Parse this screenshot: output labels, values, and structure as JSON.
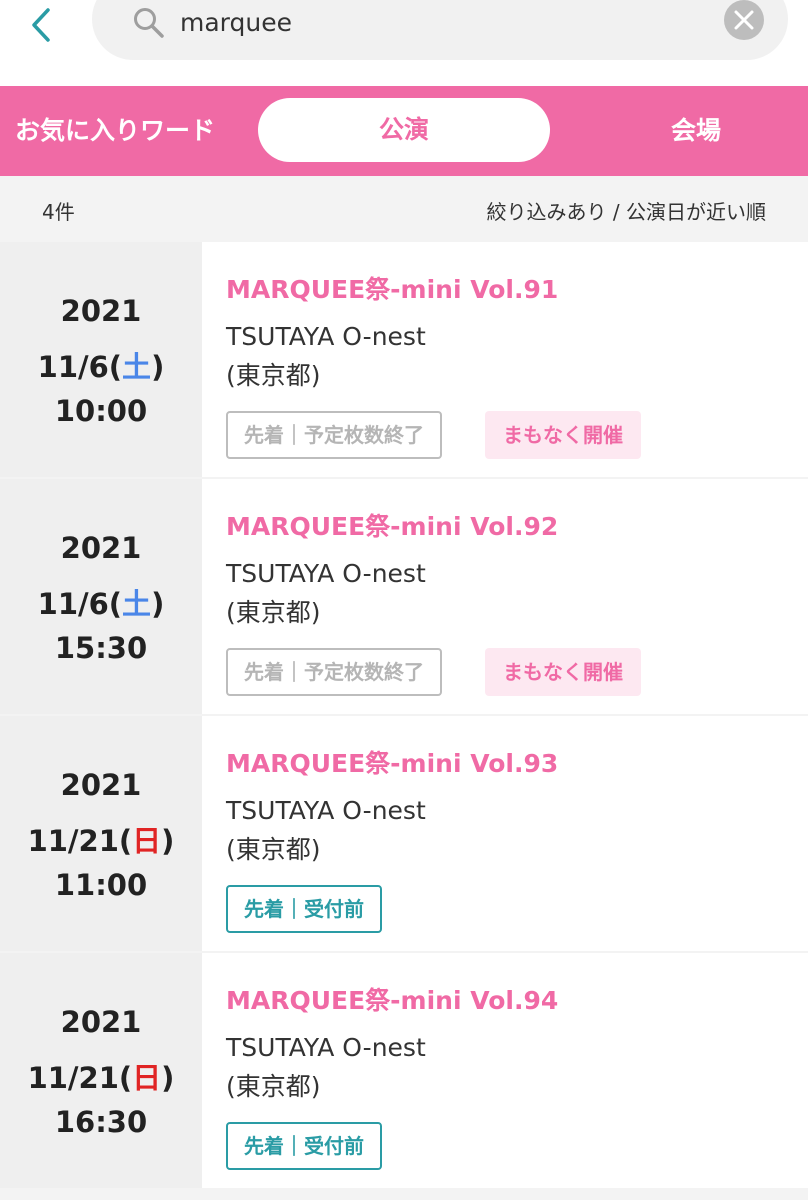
{
  "search": {
    "query": "marquee",
    "back_icon": "chevron-left-icon",
    "search_icon": "search-icon",
    "clear_icon": "close-circle-icon"
  },
  "tabs": {
    "favorites": "お気に入りワード",
    "performances": "公演",
    "venues": "会場",
    "active": "公演"
  },
  "summary": {
    "count": "4件",
    "filter_sort": "絞り込みあり / 公演日が近い順"
  },
  "colors": {
    "brand_pink": "#f06aa5",
    "teal": "#2a9ca5",
    "saturday": "#4a86e8",
    "sunday": "#e02424"
  },
  "events": [
    {
      "year": "2021",
      "date_prefix": "11/6(",
      "dow": "土",
      "date_suffix": ")",
      "time": "10:00",
      "title": "MARQUEE祭-mini Vol.91",
      "venue": "TSUTAYA O-nest",
      "prefecture": "(東京都)",
      "sale_status": "先着｜予定枚数終了",
      "soon_label": "まもなく開催"
    },
    {
      "year": "2021",
      "date_prefix": "11/6(",
      "dow": "土",
      "date_suffix": ")",
      "time": "15:30",
      "title": "MARQUEE祭-mini Vol.92",
      "venue": "TSUTAYA O-nest",
      "prefecture": "(東京都)",
      "sale_status": "先着｜予定枚数終了",
      "soon_label": "まもなく開催"
    },
    {
      "year": "2021",
      "date_prefix": "11/21(",
      "dow": "日",
      "date_suffix": ")",
      "time": "11:00",
      "title": "MARQUEE祭-mini Vol.93",
      "venue": "TSUTAYA O-nest",
      "prefecture": "(東京都)",
      "sale_status": "先着｜受付前"
    },
    {
      "year": "2021",
      "date_prefix": "11/21(",
      "dow": "日",
      "date_suffix": ")",
      "time": "16:30",
      "title": "MARQUEE祭-mini Vol.94",
      "venue": "TSUTAYA O-nest",
      "prefecture": "(東京都)",
      "sale_status": "先着｜受付前"
    }
  ]
}
